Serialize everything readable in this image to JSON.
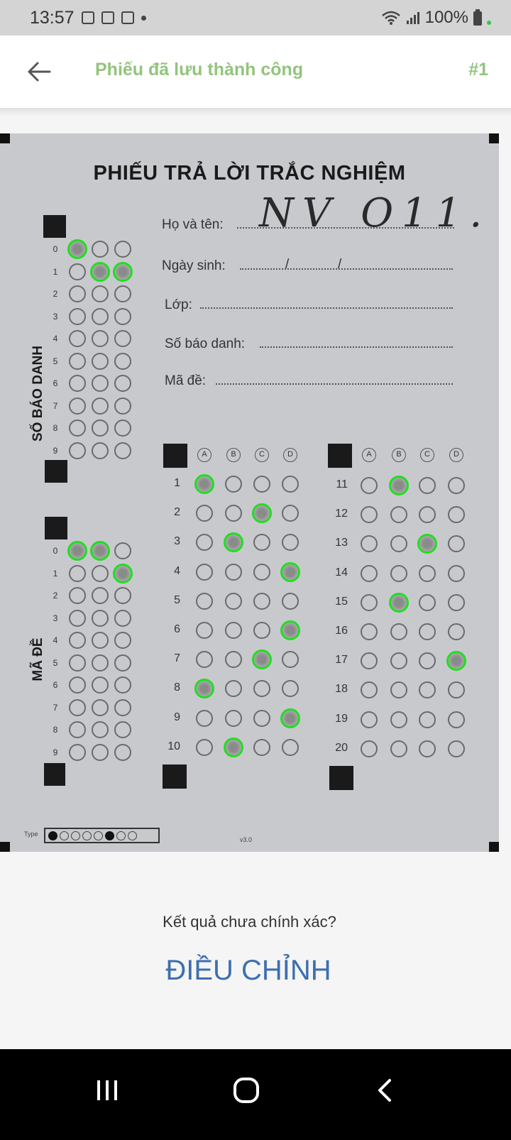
{
  "status_bar": {
    "time": "13:57",
    "battery": "100%"
  },
  "app_bar": {
    "title": "Phiếu đã lưu thành công",
    "sheet_number": "#1"
  },
  "sheet": {
    "title": "PHIẾU TRẢ LỜI TRẮC NGHIỆM",
    "handwriting": "NV O11.",
    "fields": {
      "name": "Họ và tên:",
      "dob": "Ngày sinh:",
      "class": "Lớp:",
      "id": "Số báo danh:",
      "exam_code": "Mã đề:"
    },
    "dob_separator": "/",
    "sbd_label": "SỐ BÁO DANH",
    "made_label": "MÃ ĐỀ",
    "digits": [
      "0",
      "1",
      "2",
      "3",
      "4",
      "5",
      "6",
      "7",
      "8",
      "9"
    ],
    "option_labels": [
      "A",
      "B",
      "C",
      "D"
    ],
    "sbd_selected": [
      0,
      1,
      1
    ],
    "made_selected": [
      0,
      0,
      1
    ],
    "answers": {
      "1": "A",
      "2": "C",
      "3": "B",
      "4": "D",
      "6": "D",
      "7": "C",
      "8": "A",
      "9": "D",
      "10": "B",
      "11": "B",
      "13": "C",
      "15": "B",
      "17": "D"
    },
    "version_prefix": "Type",
    "version": "v3.0"
  },
  "prompt": {
    "question": "Kết quả chưa chính xác?",
    "action": "ĐIỀU CHỈNH"
  },
  "colors": {
    "accent_green": "#93c47d",
    "detect_green": "#22dd22",
    "action_blue": "#3d6fb0"
  }
}
